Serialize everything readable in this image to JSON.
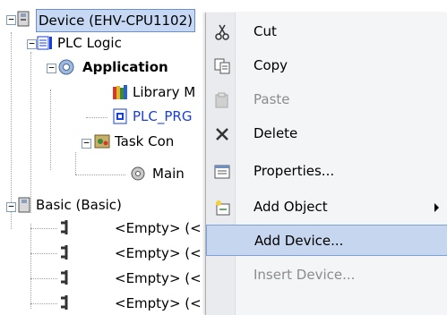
{
  "tree": {
    "device": "Device (EHV-CPU1102)",
    "plc_logic": "PLC Logic",
    "application": "Application",
    "library_manager": "Library M",
    "plc_prg": "PLC_PRG",
    "task_config": "Task Con",
    "main_task": "Main",
    "basic": "Basic (Basic)",
    "empty_slots": [
      "<Empty> (<",
      "<Empty> (<",
      "<Empty> (<",
      "<Empty> (<"
    ]
  },
  "menu": {
    "items": [
      {
        "label": "Cut",
        "icon": "scissors-icon",
        "enabled": true
      },
      {
        "label": "Copy",
        "icon": "copy-icon",
        "enabled": true
      },
      {
        "label": "Paste",
        "icon": "paste-icon",
        "enabled": false
      },
      {
        "label": "Delete",
        "icon": "delete-x-icon",
        "enabled": true
      },
      {
        "label": "Properties...",
        "icon": "properties-icon",
        "enabled": true
      },
      {
        "label": "Add Object",
        "icon": "add-object-icon",
        "enabled": true,
        "submenu": true
      },
      {
        "label": "Add Device...",
        "icon": "",
        "enabled": true,
        "highlighted": true
      },
      {
        "label": "Insert Device...",
        "icon": "",
        "enabled": false
      }
    ]
  },
  "colors": {
    "selection": "#c6d8f3",
    "menu_highlight": "#c7d6ef",
    "link_blue": "#1a3fd6",
    "disabled_text": "#8c8c8c"
  }
}
